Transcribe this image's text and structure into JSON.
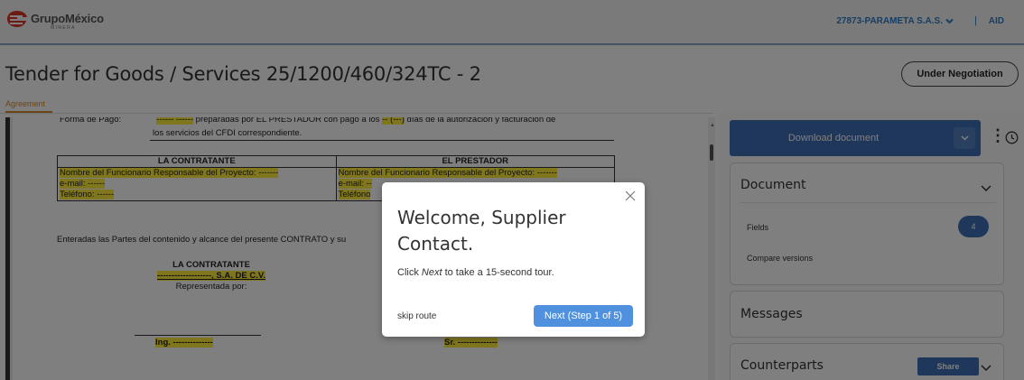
{
  "header": {
    "logo_name": "GrupoMéxico",
    "logo_sub": "MINERA",
    "company": "27873-PARAMETA S.A.S.",
    "separator": "|",
    "user": "AID"
  },
  "page": {
    "title": "Tender for Goods / Services 25/1200/460/324TC - 2",
    "status": "Under Negotiation",
    "tab_agreement": "Agreement"
  },
  "document": {
    "payment_label": "Forma de Pago:",
    "payment_hl1": "------ ------",
    "payment_text": " preparadas por EL PRESTADOR con pago a los ",
    "payment_hl2": "-- (---)",
    "payment_tail": " días de la autorización y facturación de",
    "payment_line2": "los servicios del CFDI correspondiente.",
    "col_left": "LA CONTRATANTE",
    "col_right": "EL PRESTADOR",
    "left_resp_label": "Nombre del Funcionario Responsable del Proyecto: -------",
    "left_email": "e-mail: ------",
    "left_phone": "Teléfono: ------",
    "right_resp_label": "Nombre del Funcionario Responsable del Proyecto: -------",
    "right_email": "e-mail: --",
    "right_phone": "Teléfono",
    "enteradas": "Enteradas las Partes del contenido y alcance del presente CONTRATO y su",
    "sig_left_title": "LA CONTRATANTE",
    "sig_left_company": "-------------------, S.A. DE C.V.",
    "sig_left_rep": "Representada por:",
    "sig_left_name": "Ing. --------------",
    "sig_right_name": "Sr. --------------"
  },
  "sidebar": {
    "download_label": "Download document",
    "document_title": "Document",
    "fields_label": "Fields",
    "fields_count": "4",
    "compare_label": "Compare versions",
    "messages_title": "Messages",
    "counterparts_title": "Counterparts",
    "share_label": "Share"
  },
  "tour": {
    "title": "Welcome, Supplier Contact.",
    "body_prefix": "Click ",
    "body_em": "Next",
    "body_suffix": " to take a 15-second tour.",
    "skip_label": "skip route",
    "next_label": "Next (Step 1 of 5)"
  },
  "colors": {
    "primary": "#3d6eb4",
    "tab_accent": "#d98a2c",
    "highlight": "#ffec3b",
    "next_button": "#4f91df",
    "brand_red": "#d9362b"
  }
}
